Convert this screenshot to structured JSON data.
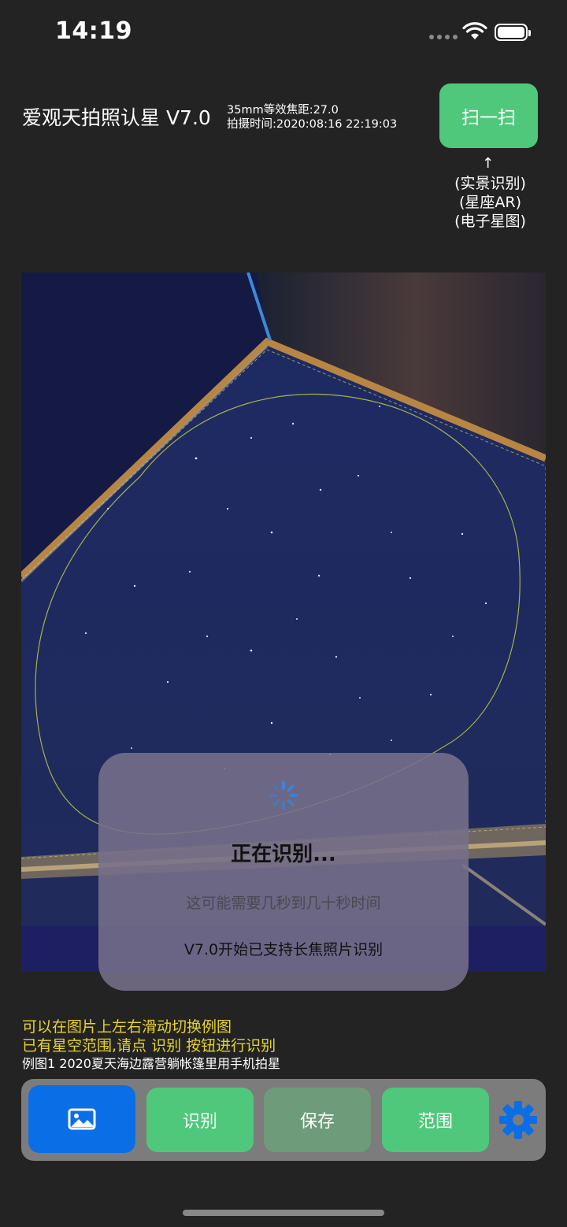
{
  "status_bar": {
    "time": "14:19"
  },
  "header": {
    "app_title": "爱观天拍照认星 V7.0",
    "focal_length": "35mm等效焦距:27.0",
    "shot_time": "拍摄时间:2020:08:16 22:19:03",
    "scan_button": "扫一扫",
    "scan_arrow": "↑",
    "scan_hints": [
      "(实景识别)",
      "(星座AR)",
      "(电子星图)"
    ]
  },
  "overlay": {
    "title": "正在识别...",
    "subtitle": "这可能需要几秒到几十秒时间",
    "note": "V7.0开始已支持长焦照片识别"
  },
  "hints": {
    "line1": "可以在图片上左右滑动切换例图",
    "line2": "已有星空范围,请点 识别 按钮进行识别",
    "line3": "例图1 2020夏天海边露营躺帐篷里用手机拍星"
  },
  "toolbar": {
    "photo_icon": "image-icon",
    "identify_label": "识别",
    "save_label": "保存",
    "range_label": "范围",
    "settings_icon": "gear-icon"
  },
  "colors": {
    "accent_green": "#4fc87b",
    "photo_button_blue": "#0a6ee6",
    "hint_yellow": "#e8d32a",
    "background": "#232323"
  }
}
